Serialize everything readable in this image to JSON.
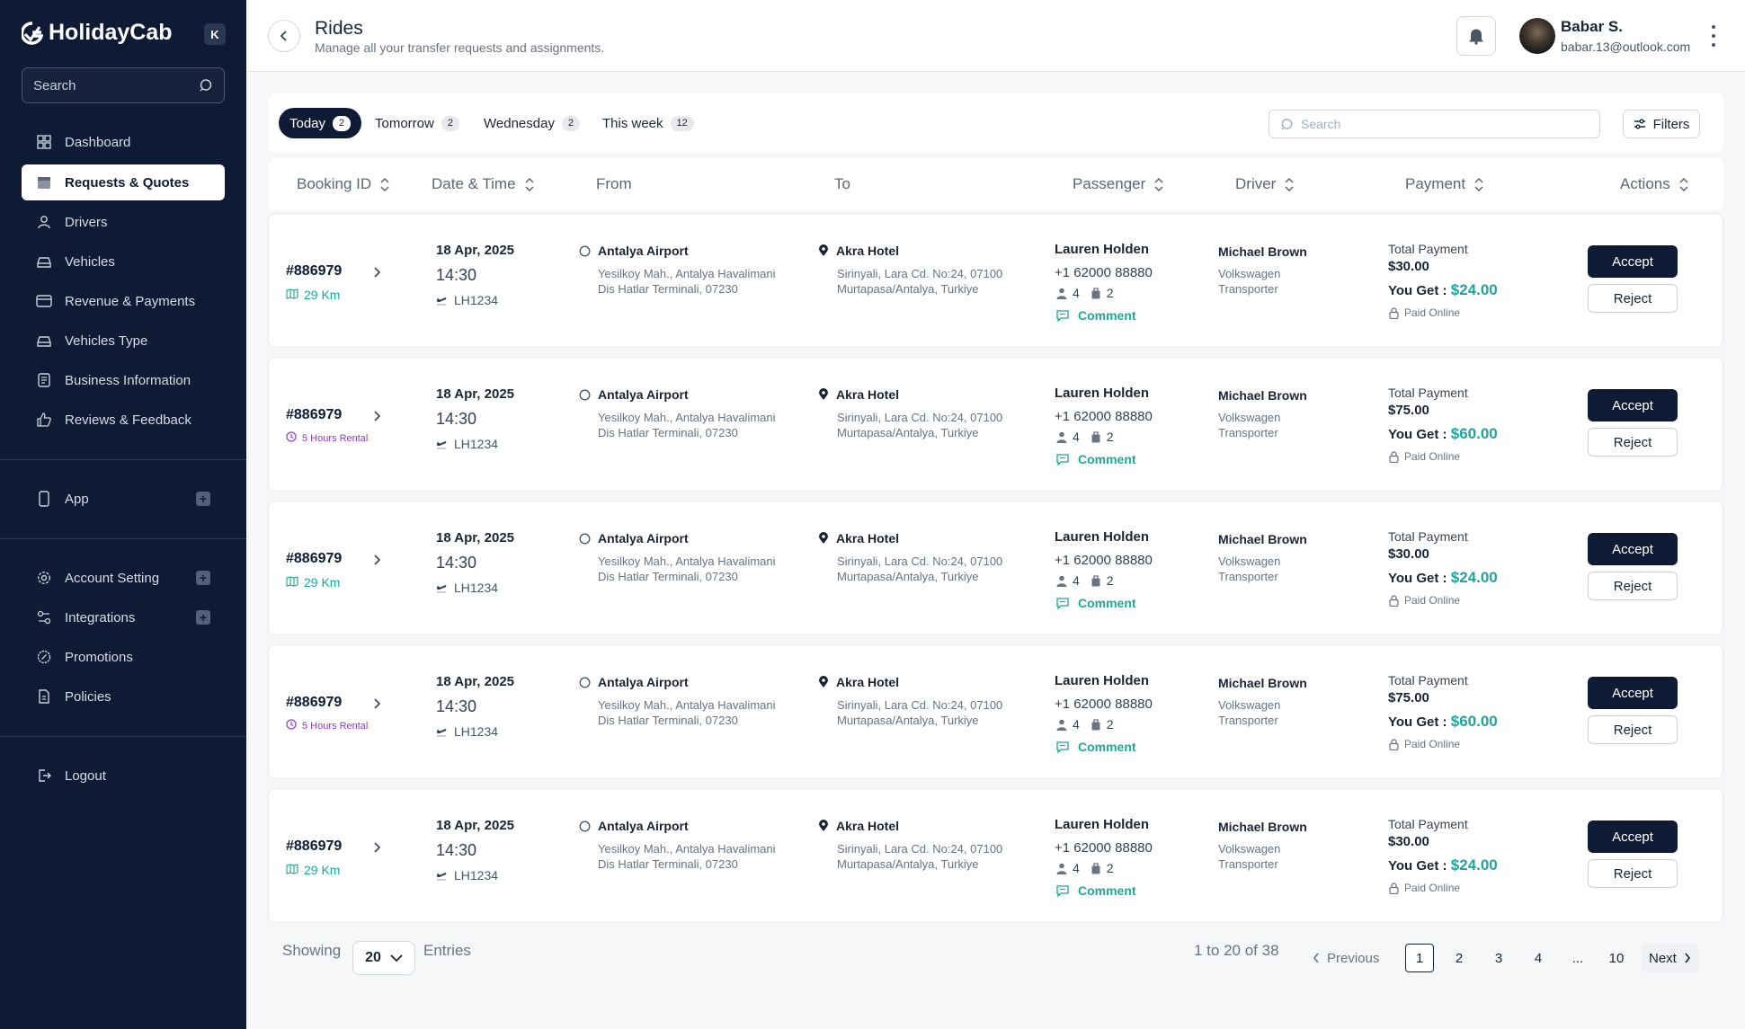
{
  "app": {
    "name": "HolidayCab",
    "collapse_label": "K"
  },
  "sidebar": {
    "search_placeholder": "Search",
    "items": [
      {
        "label": "Dashboard",
        "icon": "grid-icon"
      },
      {
        "label": "Requests & Quotes",
        "icon": "calendar-icon"
      },
      {
        "label": "Drivers",
        "icon": "user-icon"
      },
      {
        "label": "Vehicles",
        "icon": "car-icon"
      },
      {
        "label": "Revenue & Payments",
        "icon": "card-icon"
      },
      {
        "label": "Vehicles Type",
        "icon": "car-icon"
      },
      {
        "label": "Business Information",
        "icon": "document-icon"
      },
      {
        "label": "Reviews & Feedback",
        "icon": "thumbs-up-icon"
      }
    ],
    "app_item": {
      "label": "App"
    },
    "settings_items": [
      {
        "label": "Account Setting"
      },
      {
        "label": "Integrations"
      },
      {
        "label": "Promotions"
      },
      {
        "label": "Policies"
      }
    ],
    "logout": "Logout"
  },
  "header": {
    "title": "Rides",
    "subtitle": "Manage all your transfer requests and assignments.",
    "user_name": "Babar S.",
    "user_email": "babar.13@outlook.com"
  },
  "tabs": [
    {
      "label": "Today",
      "count": "2"
    },
    {
      "label": "Tomorrow",
      "count": "2"
    },
    {
      "label": "Wednesday",
      "count": "2"
    },
    {
      "label": "This week",
      "count": "12"
    }
  ],
  "toolbar": {
    "search_placeholder": "Search",
    "filters_label": "Filters"
  },
  "table": {
    "columns": [
      "Booking ID",
      "Date & Time",
      "From",
      "To",
      "Passenger",
      "Driver",
      "Payment",
      "Actions"
    ],
    "rows": [
      {
        "id": "#886979",
        "tag": "29 Km",
        "tag_type": "km",
        "date": "18 Apr, 2025",
        "time": "14:30",
        "flight": "LH1234",
        "from": "Antalya Airport",
        "from_addr1": "Yesilkoy Mah., Antalya Havalimani",
        "from_addr2": "Dis Hatlar Terminali, 07230",
        "to": "Akra Hotel",
        "to_addr1": "Sirinyali, Lara Cd. No:24, 07100",
        "to_addr2": "Murtapasa/Antalya, Turkiye",
        "passenger": "Lauren Holden",
        "phone": "+1 62000 88880",
        "pax": "4",
        "bags": "2",
        "comment": "Comment",
        "driver": "Michael Brown",
        "vehicle1": "Volkswagen",
        "vehicle2": "Transporter",
        "total_label": "Total Payment",
        "total": "$30.00",
        "you_get_label": "You Get :",
        "you_get": "$24.00",
        "paid": "Paid Online",
        "accept": "Accept",
        "reject": "Reject"
      },
      {
        "id": "#886979",
        "tag": "5 Hours Rental",
        "tag_type": "rental",
        "date": "18 Apr, 2025",
        "time": "14:30",
        "flight": "LH1234",
        "from": "Antalya Airport",
        "from_addr1": "Yesilkoy Mah., Antalya Havalimani",
        "from_addr2": "Dis Hatlar Terminali, 07230",
        "to": "Akra Hotel",
        "to_addr1": "Sirinyali, Lara Cd. No:24, 07100",
        "to_addr2": "Murtapasa/Antalya, Turkiye",
        "passenger": "Lauren Holden",
        "phone": "+1 62000 88880",
        "pax": "4",
        "bags": "2",
        "comment": "Comment",
        "driver": "Michael Brown",
        "vehicle1": "Volkswagen",
        "vehicle2": "Transporter",
        "total_label": "Total Payment",
        "total": "$75.00",
        "you_get_label": "You Get :",
        "you_get": "$60.00",
        "paid": "Paid Online",
        "accept": "Accept",
        "reject": "Reject"
      },
      {
        "id": "#886979",
        "tag": "29 Km",
        "tag_type": "km",
        "date": "18 Apr, 2025",
        "time": "14:30",
        "flight": "LH1234",
        "from": "Antalya Airport",
        "from_addr1": "Yesilkoy Mah., Antalya Havalimani",
        "from_addr2": "Dis Hatlar Terminali, 07230",
        "to": "Akra Hotel",
        "to_addr1": "Sirinyali, Lara Cd. No:24, 07100",
        "to_addr2": "Murtapasa/Antalya, Turkiye",
        "passenger": "Lauren Holden",
        "phone": "+1 62000 88880",
        "pax": "4",
        "bags": "2",
        "comment": "Comment",
        "driver": "Michael Brown",
        "vehicle1": "Volkswagen",
        "vehicle2": "Transporter",
        "total_label": "Total Payment",
        "total": "$30.00",
        "you_get_label": "You Get :",
        "you_get": "$24.00",
        "paid": "Paid Online",
        "accept": "Accept",
        "reject": "Reject"
      },
      {
        "id": "#886979",
        "tag": "5 Hours Rental",
        "tag_type": "rental",
        "date": "18 Apr, 2025",
        "time": "14:30",
        "flight": "LH1234",
        "from": "Antalya Airport",
        "from_addr1": "Yesilkoy Mah., Antalya Havalimani",
        "from_addr2": "Dis Hatlar Terminali, 07230",
        "to": "Akra Hotel",
        "to_addr1": "Sirinyali, Lara Cd. No:24, 07100",
        "to_addr2": "Murtapasa/Antalya, Turkiye",
        "passenger": "Lauren Holden",
        "phone": "+1 62000 88880",
        "pax": "4",
        "bags": "2",
        "comment": "Comment",
        "driver": "Michael Brown",
        "vehicle1": "Volkswagen",
        "vehicle2": "Transporter",
        "total_label": "Total Payment",
        "total": "$75.00",
        "you_get_label": "You Get :",
        "you_get": "$60.00",
        "paid": "Paid Online",
        "accept": "Accept",
        "reject": "Reject"
      },
      {
        "id": "#886979",
        "tag": "29 Km",
        "tag_type": "km",
        "date": "18 Apr, 2025",
        "time": "14:30",
        "flight": "LH1234",
        "from": "Antalya Airport",
        "from_addr1": "Yesilkoy Mah., Antalya Havalimani",
        "from_addr2": "Dis Hatlar Terminali, 07230",
        "to": "Akra Hotel",
        "to_addr1": "Sirinyali, Lara Cd. No:24, 07100",
        "to_addr2": "Murtapasa/Antalya, Turkiye",
        "passenger": "Lauren Holden",
        "phone": "+1 62000 88880",
        "pax": "4",
        "bags": "2",
        "comment": "Comment",
        "driver": "Michael Brown",
        "vehicle1": "Volkswagen",
        "vehicle2": "Transporter",
        "total_label": "Total Payment",
        "total": "$30.00",
        "you_get_label": "You Get :",
        "you_get": "$24.00",
        "paid": "Paid Online",
        "accept": "Accept",
        "reject": "Reject"
      }
    ]
  },
  "footer": {
    "showing": "Showing",
    "per_page": "20",
    "entries": "Entries",
    "range": "1 to 20 of 38",
    "previous": "Previous",
    "pages": [
      "1",
      "2",
      "3",
      "4",
      "...",
      "10"
    ],
    "next": "Next"
  },
  "colors": {
    "sidebar_bg": "#0f1b34",
    "accent_teal": "#1aa89b",
    "rental_purple": "#8a3ec9"
  }
}
